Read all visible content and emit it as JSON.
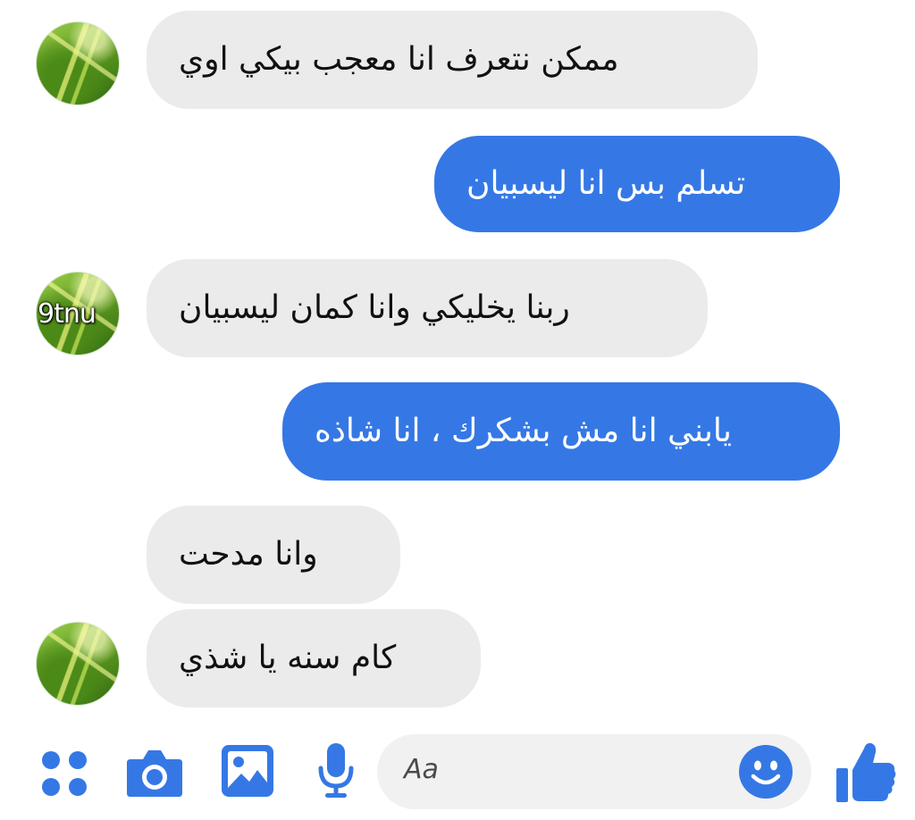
{
  "conversation": {
    "avatar_watermark": "9tnu",
    "messages": [
      {
        "sender": "contact",
        "text": "ممكن نتعرف انا معجب بيكي اوي"
      },
      {
        "sender": "me",
        "text": "تسلم بس انا ليسبيان"
      },
      {
        "sender": "contact",
        "text": "ربنا يخليكي وانا كمان ليسبيان"
      },
      {
        "sender": "me",
        "text": "يابني انا مش بشكرك ، انا شاذه"
      },
      {
        "sender": "contact",
        "text": "وانا مدحت"
      },
      {
        "sender": "contact",
        "text": "كام سنه يا شذي"
      }
    ]
  },
  "composer": {
    "placeholder": "Aa",
    "icons": [
      "apps-grid-icon",
      "camera-icon",
      "gallery-icon",
      "microphone-icon",
      "emoji-icon",
      "thumbs-up-icon"
    ]
  },
  "colors": {
    "accent": "#3578e5",
    "incoming_bubble": "#ebebeb",
    "outgoing_text": "#ffffff"
  }
}
